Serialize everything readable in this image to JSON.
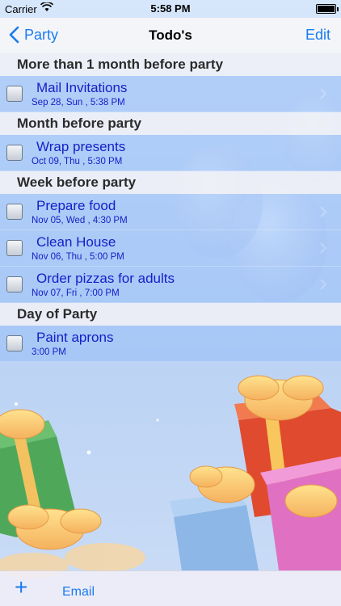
{
  "status_bar": {
    "carrier": "Carrier",
    "time": "5:58 PM"
  },
  "nav": {
    "back_label": "Party",
    "title": "Todo's",
    "edit_label": "Edit"
  },
  "sections": [
    {
      "header": "More than 1 month before party",
      "items": [
        {
          "title": "Mail Invitations",
          "date": "Sep 28, Sun , 5:38 PM"
        }
      ]
    },
    {
      "header": "Month before party",
      "items": [
        {
          "title": "Wrap presents",
          "date": "Oct 09, Thu , 5:30 PM"
        }
      ]
    },
    {
      "header": "Week before party",
      "items": [
        {
          "title": "Prepare food",
          "date": "Nov 05, Wed , 4:30 PM"
        },
        {
          "title": "Clean House",
          "date": "Nov 06, Thu , 5:00 PM"
        },
        {
          "title": "Order pizzas for adults",
          "date": "Nov 07, Fri , 7:00 PM"
        }
      ]
    },
    {
      "header": "Day of Party",
      "items": [
        {
          "title": "Paint aprons",
          "date": "3:00 PM"
        }
      ]
    }
  ],
  "toolbar": {
    "add_label": "+",
    "email_label": "Email"
  },
  "colors": {
    "accent": "#1a7bf0",
    "item_text": "#1520c8",
    "row_background": "#96bef8"
  }
}
